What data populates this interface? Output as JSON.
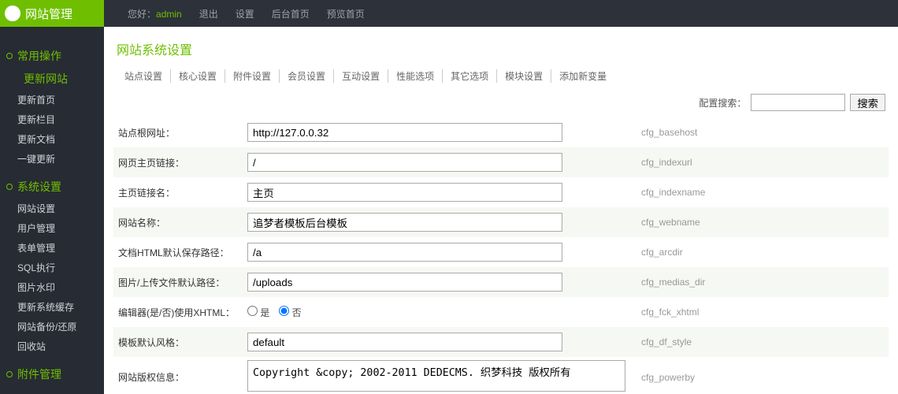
{
  "brand": "网站管理",
  "topnav": {
    "hello": "您好：",
    "user": "admin",
    "items": [
      "退出",
      "设置",
      "后台首页",
      "预览首页"
    ]
  },
  "sidebar": {
    "groups": [
      {
        "title": "常用操作",
        "sub": "更新网站",
        "items": [
          "更新首页",
          "更新栏目",
          "更新文档",
          "一键更新"
        ]
      },
      {
        "title": "系统设置",
        "items": [
          "网站设置",
          "用户管理",
          "表单管理",
          "SQL执行",
          "图片水印",
          "更新系统缓存",
          "网站备份/还原",
          "回收站"
        ]
      },
      {
        "title": "附件管理",
        "items": []
      }
    ]
  },
  "page_title": "网站系统设置",
  "tabs": [
    "站点设置",
    "核心设置",
    "附件设置",
    "会员设置",
    "互动设置",
    "性能选项",
    "其它选项",
    "模块设置",
    "添加新变量"
  ],
  "search": {
    "label": "配置搜索：",
    "btn": "搜索"
  },
  "rows": [
    {
      "label": "站点根网址：",
      "value": "http://127.0.0.32",
      "var": "cfg_basehost",
      "type": "text"
    },
    {
      "label": "网页主页链接：",
      "value": "/",
      "var": "cfg_indexurl",
      "type": "text"
    },
    {
      "label": "主页链接名：",
      "value": "主页",
      "var": "cfg_indexname",
      "type": "text"
    },
    {
      "label": "网站名称：",
      "value": "追梦者模板后台模板",
      "var": "cfg_webname",
      "type": "text"
    },
    {
      "label": "文档HTML默认保存路径：",
      "value": "/a",
      "var": "cfg_arcdir",
      "type": "text"
    },
    {
      "label": "图片/上传文件默认路径：",
      "value": "/uploads",
      "var": "cfg_medias_dir",
      "type": "text"
    },
    {
      "label": "编辑器(是/否)使用XHTML：",
      "yes": "是",
      "no": "否",
      "var": "cfg_fck_xhtml",
      "type": "radio"
    },
    {
      "label": "模板默认风格：",
      "value": "default",
      "var": "cfg_df_style",
      "type": "text"
    },
    {
      "label": "网站版权信息：",
      "value": "Copyright &copy; 2002-2011 DEDECMS. 织梦科技 版权所有",
      "var": "cfg_powerby",
      "type": "textarea"
    }
  ]
}
